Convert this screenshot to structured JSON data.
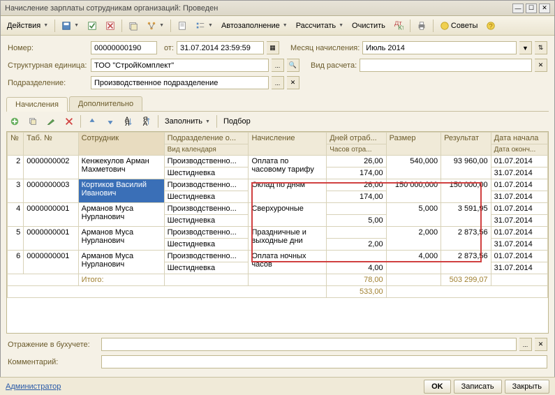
{
  "window": {
    "title": "Начисление зарплаты сотрудникам организаций: Проведен"
  },
  "toolbar": {
    "actions": "Действия",
    "autofill": "Автозаполнение",
    "calc": "Рассчитать",
    "clear": "Очистить",
    "tips": "Советы"
  },
  "form": {
    "number_label": "Номер:",
    "number": "00000000190",
    "from_label": "от:",
    "date": "31.07.2014 23:59:59",
    "month_label": "Месяц начисления:",
    "month": "Июль 2014",
    "unit_label": "Структурная единица:",
    "unit": "ТОО \"СтройКомплект\"",
    "calc_type_label": "Вид расчета:",
    "calc_type": "",
    "dept_label": "Подразделение:",
    "dept": "Производственное подразделение"
  },
  "tabs": {
    "t1": "Начисления",
    "t2": "Дополнительно"
  },
  "inner_tb": {
    "fill": "Заполнить",
    "selection": "Подбор"
  },
  "grid": {
    "cols": {
      "n": "№",
      "tab": "Таб. №",
      "emp": "Сотрудник",
      "dept": "Подразделение о...",
      "cal": "Вид календаря",
      "accr": "Начисление",
      "days": "Дней отраб...",
      "hours": "Часов отра...",
      "size": "Размер",
      "result": "Результат",
      "dstart": "Дата начала",
      "dend": "Дата оконч..."
    },
    "rows": [
      {
        "n": "2",
        "tab": "0000000002",
        "emp": "Кенжекулов Арман Махметович",
        "dept": "Производственно...",
        "cal": "Шестидневка",
        "accr": "Оплата по часовому тарифу",
        "days": "26,00",
        "hours": "174,00",
        "size": "540,000",
        "result": "93 960,00",
        "dstart": "01.07.2014",
        "dend": "31.07.2014"
      },
      {
        "n": "3",
        "tab": "0000000003",
        "emp": "Кортиков Василий Иванович",
        "dept": "Производственно...",
        "cal": "Шестидневка",
        "accr": "Оклад по дням",
        "days": "26,00",
        "hours": "174,00",
        "size": "150 000,000",
        "result": "150 000,00",
        "dstart": "01.07.2014",
        "dend": "31.07.2014",
        "selected": true
      },
      {
        "n": "4",
        "tab": "0000000001",
        "emp": "Арманов Муса Нурланович",
        "dept": "Производственно...",
        "cal": "Шестидневка",
        "accr": "Сверхурочные",
        "days": "",
        "hours": "5,00",
        "size": "5,000",
        "result": "3 591,95",
        "dstart": "01.07.2014",
        "dend": "31.07.2014"
      },
      {
        "n": "5",
        "tab": "0000000001",
        "emp": "Арманов Муса Нурланович",
        "dept": "Производственно...",
        "cal": "Шестидневка",
        "accr": "Праздничные и выходные дни",
        "days": "",
        "hours": "2,00",
        "size": "2,000",
        "result": "2 873,56",
        "dstart": "01.07.2014",
        "dend": "31.07.2014"
      },
      {
        "n": "6",
        "tab": "0000000001",
        "emp": "Арманов Муса Нурланович",
        "dept": "Производственно...",
        "cal": "Шестидневка",
        "accr": "Оплата ночных часов",
        "days": "",
        "hours": "4,00",
        "size": "4,000",
        "result": "2 873,56",
        "dstart": "01.07.2014",
        "dend": "31.07.2014"
      }
    ],
    "totals": {
      "label": "Итого:",
      "days": "78,00",
      "hours": "533,00",
      "result": "503 299,07"
    }
  },
  "bottom": {
    "accounting_label": "Отражение в бухучете:",
    "accounting": "",
    "comment_label": "Комментарий:",
    "comment": ""
  },
  "footer": {
    "user": "Администратор",
    "ok": "OK",
    "save": "Записать",
    "close": "Закрыть"
  }
}
